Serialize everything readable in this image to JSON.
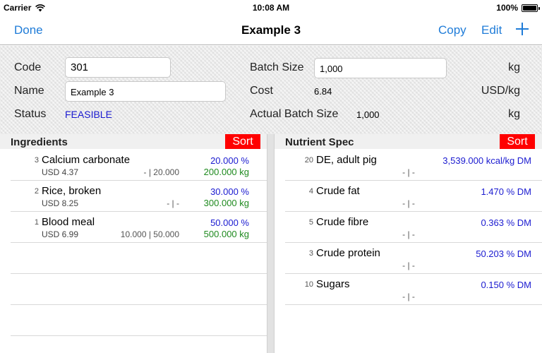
{
  "status_bar": {
    "carrier": "Carrier",
    "time": "10:08 AM",
    "battery": "100%"
  },
  "nav": {
    "done": "Done",
    "title": "Example 3",
    "copy": "Copy",
    "edit": "Edit"
  },
  "form": {
    "code_label": "Code",
    "code_value": "301",
    "name_label": "Name",
    "name_value": "Example 3",
    "status_label": "Status",
    "status_value": "FEASIBLE",
    "batch_label": "Batch Size",
    "batch_value": "1,000",
    "batch_unit": "kg",
    "cost_label": "Cost",
    "cost_value": "6.84",
    "cost_unit": "USD/kg",
    "actual_label": "Actual Batch Size",
    "actual_value": "1,000",
    "actual_unit": "kg"
  },
  "ingredients": {
    "title": "Ingredients",
    "sort": "Sort",
    "rows": [
      {
        "index": "3",
        "name": "Calcium carbonate",
        "price": "USD 4.37",
        "limits": "- | 20.000",
        "pct": "20.000 %",
        "kg": "200.000 kg"
      },
      {
        "index": "2",
        "name": "Rice, broken",
        "price": "USD 8.25",
        "limits": "- | -",
        "pct": "30.000 %",
        "kg": "300.000 kg"
      },
      {
        "index": "1",
        "name": "Blood meal",
        "price": "USD 6.99",
        "limits": "10.000 | 50.000",
        "pct": "50.000 %",
        "kg": "500.000 kg"
      }
    ]
  },
  "nutrients": {
    "title": "Nutrient Spec",
    "sort": "Sort",
    "rows": [
      {
        "index": "20",
        "name": "DE, adult pig",
        "limits": "- | -",
        "value": "3,539.000 kcal/kg DM"
      },
      {
        "index": "4",
        "name": "Crude fat",
        "limits": "- | -",
        "value": "1.470 % DM"
      },
      {
        "index": "5",
        "name": "Crude fibre",
        "limits": "- | -",
        "value": "0.363 % DM"
      },
      {
        "index": "3",
        "name": "Crude protein",
        "limits": "- | -",
        "value": "50.203 % DM"
      },
      {
        "index": "10",
        "name": "Sugars",
        "limits": "- | -",
        "value": "0.150 % DM"
      }
    ]
  }
}
